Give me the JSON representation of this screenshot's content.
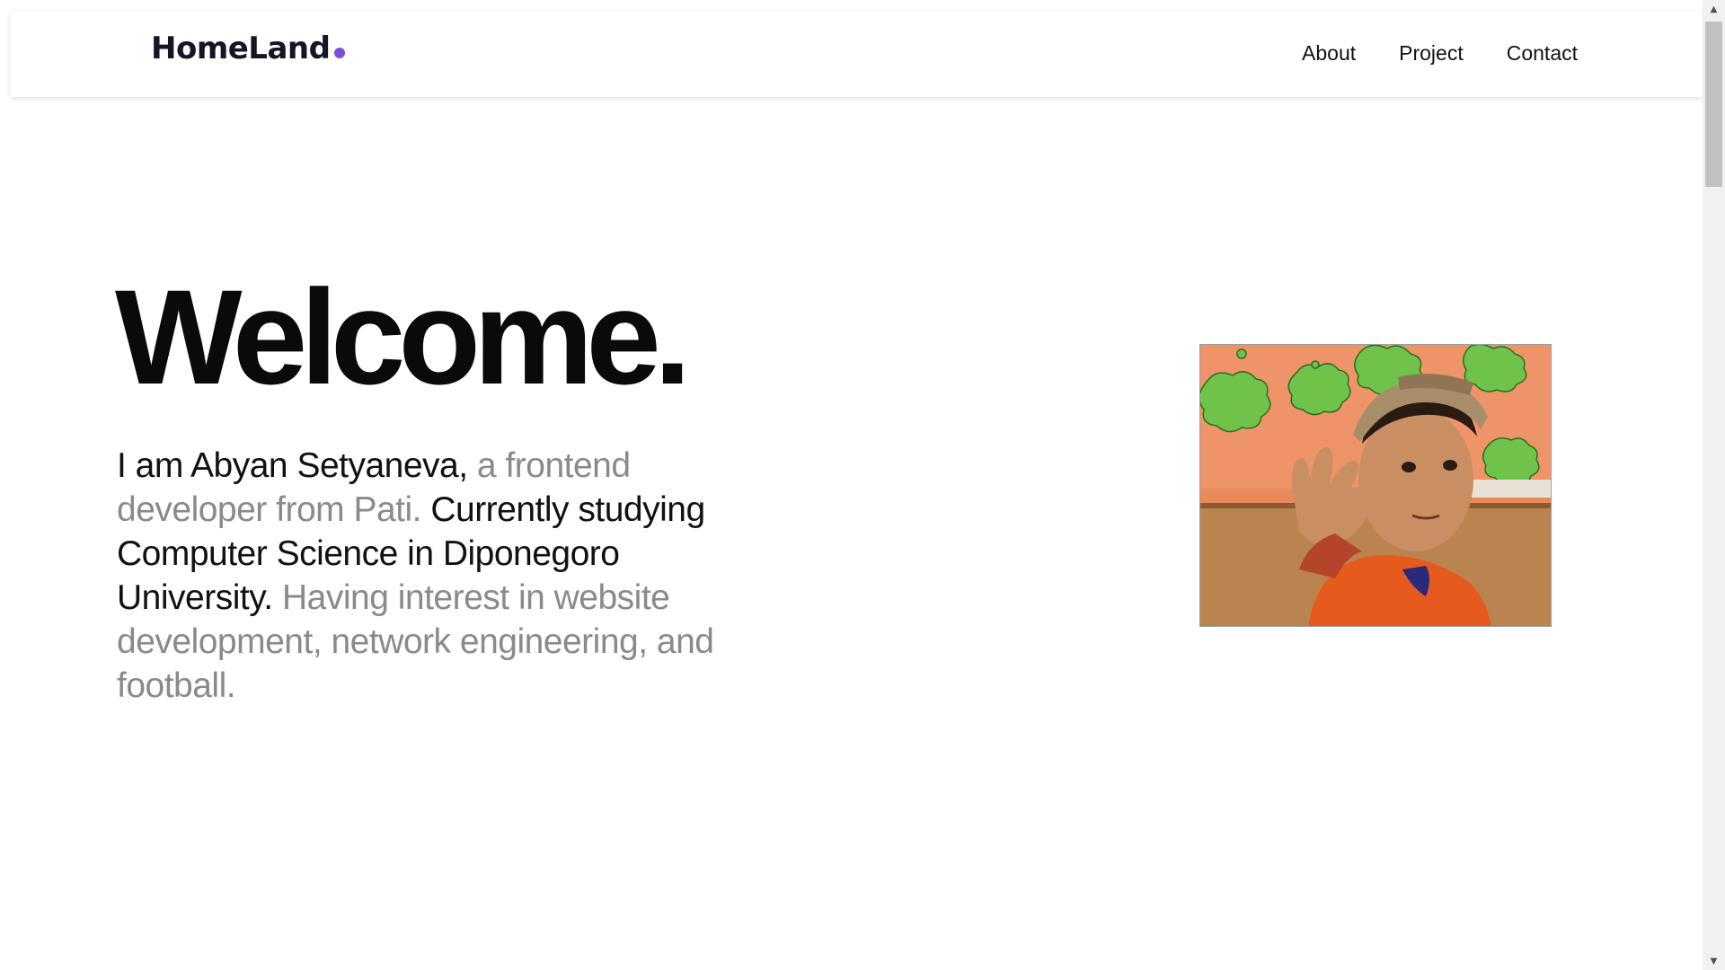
{
  "navbar": {
    "brand": "HomeLand",
    "brand_dot_color": "#7b4fd6",
    "links": [
      {
        "label": "About"
      },
      {
        "label": "Project"
      },
      {
        "label": "Contact"
      }
    ]
  },
  "hero": {
    "title": "Welcome.",
    "intro": [
      {
        "text": "I am Abyan Setyaneva, ",
        "tone": "dark"
      },
      {
        "text": "a frontend developer from Pati. ",
        "tone": "gray"
      },
      {
        "text": "Currently studying Computer Science in Diponegoro University. ",
        "tone": "dark"
      },
      {
        "text": "Having interest in website development, network engineering, and football.",
        "tone": "gray"
      }
    ]
  },
  "profile_photo": {
    "alt": "Profile photo of a child in a cap making a hand sign"
  },
  "colors": {
    "text_dark": "#111111",
    "text_gray": "#8a8a8a",
    "accent": "#7b4fd6"
  }
}
